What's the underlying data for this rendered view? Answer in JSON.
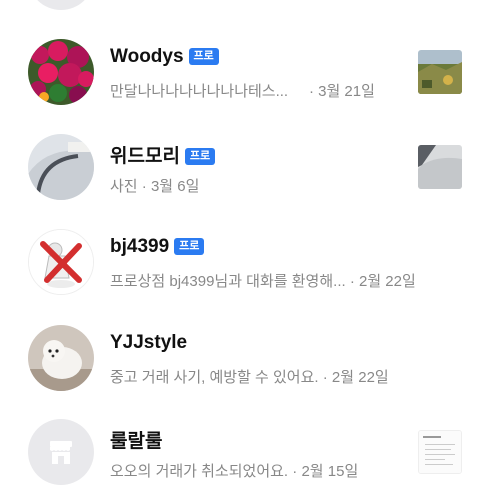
{
  "chat_list": {
    "items": [
      {
        "name": "Woodys",
        "badge": "프로",
        "preview": "만달나나나나나나나나테스...",
        "time": "· 3월 21일",
        "avatar_icon": "flower-photo-avatar",
        "thumbnail_icon": "landscape-photo-thumbnail"
      },
      {
        "name": "위드모리",
        "badge": "프로",
        "preview": "사진",
        "time": "· 3월 6일",
        "avatar_icon": "interior-photo-avatar",
        "thumbnail_icon": "room-photo-thumbnail"
      },
      {
        "name": "bj4399",
        "badge": "프로",
        "preview": "프로상점 bj4399님과 대화를 환영해...",
        "time": "· 2월 22일",
        "avatar_icon": "character-avatar",
        "thumbnail_icon": ""
      },
      {
        "name": "YJJstyle",
        "badge": "",
        "preview": "중고 거래 사기, 예방할 수 있어요.",
        "time": "· 2월 22일",
        "avatar_icon": "dog-photo-avatar",
        "thumbnail_icon": ""
      },
      {
        "name": "룰랄룰",
        "badge": "",
        "preview": "오오의 거래가 취소되었어요.",
        "time": "· 2월 15일",
        "avatar_icon": "store-icon",
        "thumbnail_icon": "document-thumbnail"
      }
    ]
  },
  "colors": {
    "badge": "#2b7bf1",
    "name": "#111111",
    "preview": "#888888",
    "avatar_placeholder": "#e9e9ec"
  }
}
